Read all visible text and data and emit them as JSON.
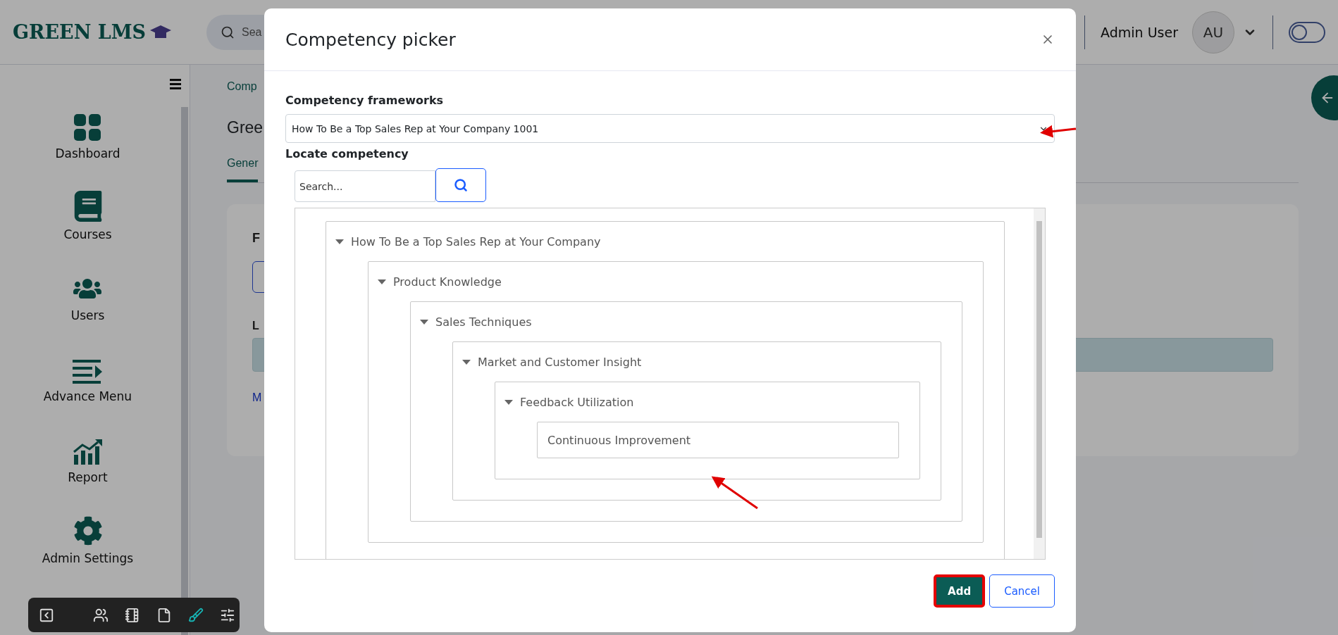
{
  "header": {
    "logo": "GREEN LMS",
    "search": {
      "placeholder": "Sea"
    },
    "user": {
      "name": "Admin User",
      "initials": "AU"
    },
    "theme_toggle": {
      "on": false
    }
  },
  "sidebar": {
    "items": [
      {
        "label": "Dashboard"
      },
      {
        "label": "Courses"
      },
      {
        "label": "Users"
      },
      {
        "label": "Advance Menu"
      },
      {
        "label": "Report"
      },
      {
        "label": "Admin Settings"
      }
    ]
  },
  "page": {
    "breadcrumb": "Comp",
    "title": "Gree",
    "tabs": [
      {
        "label": "Gener",
        "selected": true
      }
    ],
    "card": {
      "heading": "F",
      "label": "L",
      "link": "M"
    }
  },
  "toolbar": {
    "items": [
      {
        "kind": "back",
        "selected": false
      },
      {
        "kind": "users",
        "selected": false
      },
      {
        "kind": "notebook",
        "selected": false
      },
      {
        "kind": "file",
        "selected": false
      },
      {
        "kind": "brush",
        "selected": true
      },
      {
        "kind": "sliders",
        "selected": false
      }
    ]
  },
  "modal": {
    "title": "Competency picker",
    "frameworks_label": "Competency frameworks",
    "framework": "How To Be a Top Sales Rep at Your Company 1001",
    "locate_label": "Locate competency",
    "search": {
      "placeholder": "Search..."
    },
    "tree": [
      {
        "label": "How To Be a Top Sales Rep at Your Company",
        "expanded": true,
        "children": [
          {
            "label": "Product Knowledge",
            "expanded": true,
            "children": [
              {
                "label": "Sales Techniques",
                "expanded": true,
                "children": [
                  {
                    "label": "Market and Customer Insight",
                    "expanded": true,
                    "children": [
                      {
                        "label": "Feedback Utilization",
                        "expanded": true,
                        "children": [
                          {
                            "label": "Continuous Improvement"
                          }
                        ]
                      }
                    ]
                  }
                ]
              }
            ]
          }
        ]
      }
    ],
    "buttons": {
      "add": "Add",
      "cancel": "Cancel"
    }
  }
}
